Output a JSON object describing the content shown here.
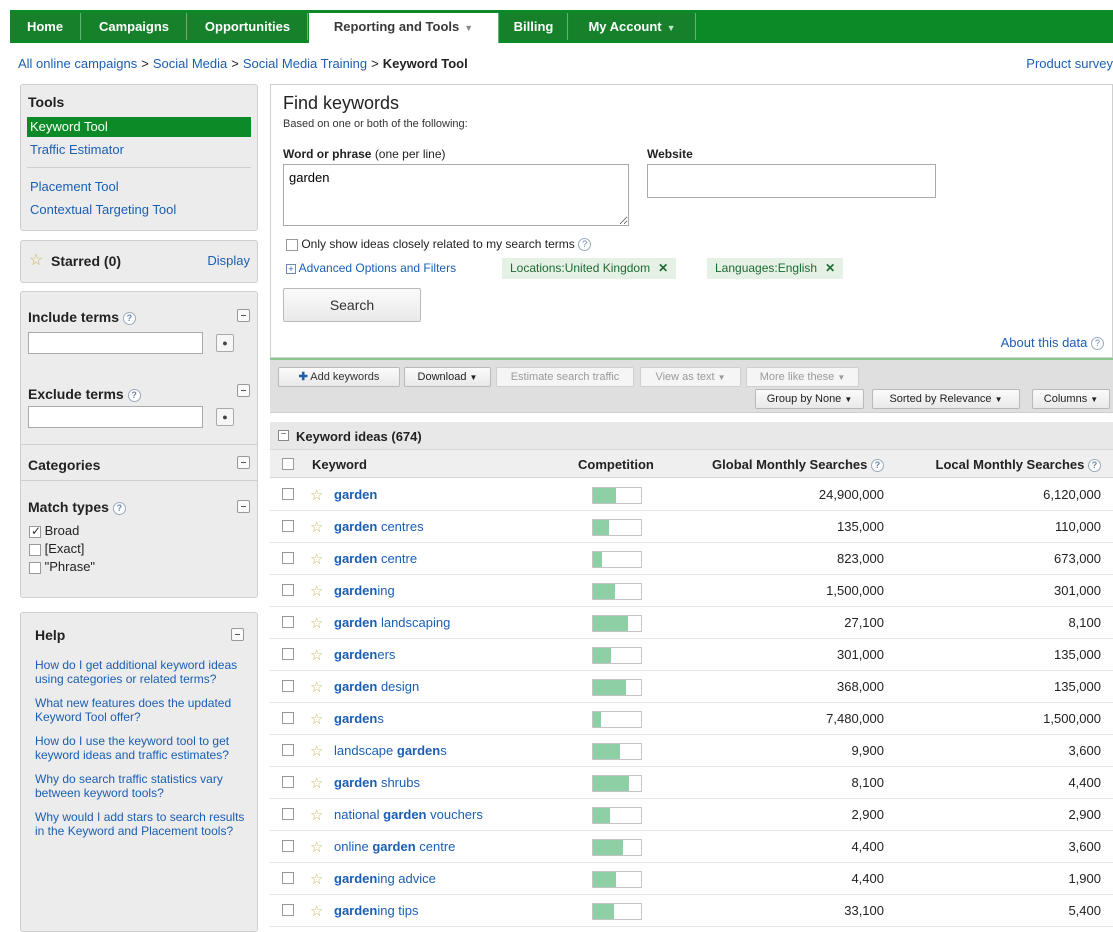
{
  "nav": {
    "tabs": [
      {
        "label": "Home"
      },
      {
        "label": "Campaigns"
      },
      {
        "label": "Opportunities"
      },
      {
        "label": "Reporting and Tools"
      },
      {
        "label": "Billing"
      },
      {
        "label": "My Account"
      }
    ]
  },
  "breadcrumb": {
    "items": [
      "All online campaigns",
      "Social Media",
      "Social Media Training"
    ],
    "separator": ">",
    "current": "Keyword Tool",
    "product_survey": "Product survey"
  },
  "tools": {
    "title": "Tools",
    "items": [
      "Keyword Tool",
      "Traffic Estimator",
      "Placement Tool",
      "Contextual Targeting Tool"
    ]
  },
  "starred": {
    "label": "Starred (0)",
    "display_link": "Display"
  },
  "filters": {
    "include_label": "Include terms",
    "exclude_label": "Exclude terms",
    "categories_label": "Categories",
    "match_types_label": "Match types",
    "match_types": [
      {
        "label": "Broad",
        "checked": true
      },
      {
        "label": "[Exact]",
        "checked": false
      },
      {
        "label": "\"Phrase\"",
        "checked": false
      }
    ]
  },
  "help": {
    "title": "Help",
    "links": [
      "How do I get additional keyword ideas using categories or related terms?",
      "What new features does the updated Keyword Tool offer?",
      "How do I use the keyword tool to get keyword ideas and traffic estimates?",
      "Why do search traffic statistics vary between keyword tools?",
      "Why would I add stars to search results in the Keyword and Placement tools?"
    ]
  },
  "find": {
    "title": "Find keywords",
    "subtitle": "Based on one or both of the following:",
    "word_label": "Word or phrase",
    "word_hint": "(one per line)",
    "word_value": "garden",
    "website_label": "Website",
    "website_value": "",
    "closely_related": "Only show ideas closely related to my search terms",
    "advanced": "Advanced Options and Filters",
    "tags": [
      "Locations:United Kingdom",
      "Languages:English"
    ],
    "search_button": "Search",
    "about_data": "About this data"
  },
  "toolbar": {
    "add_keywords": "Add keywords",
    "download": "Download",
    "estimate": "Estimate search traffic",
    "view_as_text": "View as text",
    "more_like": "More like these",
    "group_by": "Group by None",
    "sorted_by": "Sorted by Relevance",
    "columns": "Columns"
  },
  "table": {
    "section_title": "Keyword ideas (674)",
    "headers": {
      "keyword": "Keyword",
      "competition": "Competition",
      "global": "Global Monthly Searches",
      "local": "Local Monthly Searches"
    },
    "rows": [
      {
        "pre": "",
        "bold": "garden",
        "post": "",
        "competition": 0.48,
        "global": "24,900,000",
        "local": "6,120,000"
      },
      {
        "pre": "",
        "bold": "garden",
        "post": " centres",
        "competition": 0.34,
        "global": "135,000",
        "local": "110,000"
      },
      {
        "pre": "",
        "bold": "garden",
        "post": " centre",
        "competition": 0.18,
        "global": "823,000",
        "local": "673,000"
      },
      {
        "pre": "",
        "bold": "garden",
        "post": "ing",
        "competition": 0.46,
        "global": "1,500,000",
        "local": "301,000"
      },
      {
        "pre": "",
        "bold": "garden",
        "post": " landscaping",
        "competition": 0.72,
        "global": "27,100",
        "local": "8,100"
      },
      {
        "pre": "",
        "bold": "garden",
        "post": "ers",
        "competition": 0.38,
        "global": "301,000",
        "local": "135,000"
      },
      {
        "pre": "",
        "bold": "garden",
        "post": " design",
        "competition": 0.68,
        "global": "368,000",
        "local": "135,000"
      },
      {
        "pre": "",
        "bold": "garden",
        "post": "s",
        "competition": 0.16,
        "global": "7,480,000",
        "local": "1,500,000"
      },
      {
        "pre": "landscape ",
        "bold": "garden",
        "post": "s",
        "competition": 0.56,
        "global": "9,900",
        "local": "3,600"
      },
      {
        "pre": "",
        "bold": "garden",
        "post": " shrubs",
        "competition": 0.76,
        "global": "8,100",
        "local": "4,400"
      },
      {
        "pre": "national ",
        "bold": "garden",
        "post": " vouchers",
        "competition": 0.36,
        "global": "2,900",
        "local": "2,900"
      },
      {
        "pre": "online ",
        "bold": "garden",
        "post": " centre",
        "competition": 0.62,
        "global": "4,400",
        "local": "3,600"
      },
      {
        "pre": "",
        "bold": "garden",
        "post": "ing advice",
        "competition": 0.48,
        "global": "4,400",
        "local": "1,900"
      },
      {
        "pre": "",
        "bold": "garden",
        "post": "ing tips",
        "competition": 0.44,
        "global": "33,100",
        "local": "5,400"
      }
    ]
  }
}
